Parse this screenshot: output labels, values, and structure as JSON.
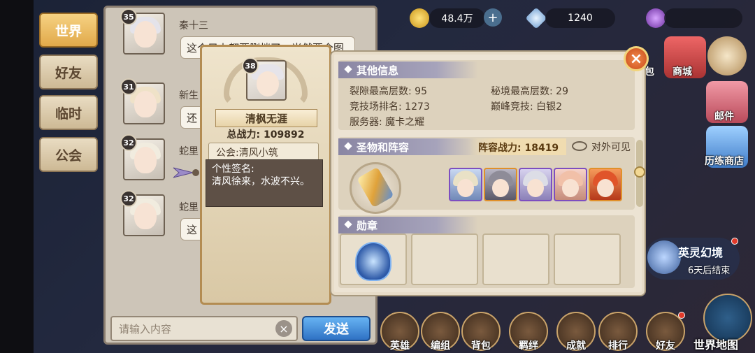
{
  "tabs": [
    {
      "label": "世界",
      "active": true
    },
    {
      "label": "好友",
      "active": false
    },
    {
      "label": "临时",
      "active": false
    },
    {
      "label": "公会",
      "active": false
    }
  ],
  "chat": [
    {
      "level": "35",
      "name": "秦十三",
      "message": "这个只上都要删档了，当然要全图"
    },
    {
      "level": "31",
      "name": "新生",
      "message": "还"
    },
    {
      "level": "32",
      "name": "蛇里",
      "message": ""
    },
    {
      "level": "32",
      "name": "蛇里",
      "message": "这"
    }
  ],
  "input": {
    "placeholder": "请输入内容",
    "send_label": "发送",
    "clear_symbol": "×"
  },
  "profile": {
    "level": "38",
    "name": "清枫无涯",
    "power_label": "总战力:",
    "power_value": "109892",
    "guild": "公会:清风小筑",
    "signature_label": "个性签名:",
    "signature_text": "清风徐来，水波不兴。"
  },
  "detail": {
    "other_title": "其他信息",
    "rift_label": "裂隙最高层数: 95",
    "secret_label": "秘境最高层数: 29",
    "arena_label": "竞技场排名: 1273",
    "peak_label": "巅峰竞技: 白银2",
    "server_label": "服务器: 魔卡之耀",
    "lineup_title": "圣物和阵容",
    "lineup_power": "阵容战力: 18419",
    "visibility": "对外可见",
    "medal_title": "勋章",
    "close_symbol": "×"
  },
  "heroes": [
    {
      "hair": "#e9e1c6",
      "accent": "#7d4ec0"
    },
    {
      "hair": "#8e8c98",
      "accent": "#e0902a"
    },
    {
      "hair": "#dcdde6",
      "accent": "#7d4ec0"
    },
    {
      "hair": "#f1c0a8",
      "accent": "#7d4ec0"
    },
    {
      "hair": "#e0542a",
      "accent": "#e0902a"
    }
  ],
  "topbar": {
    "gold": "48.4万",
    "plus": "+",
    "diamonds": "1240"
  },
  "side": {
    "shop": "商城",
    "mail": "邮件",
    "trial_shop": "历练商店",
    "partial_top": "包"
  },
  "event": {
    "title": "英灵幻境",
    "subtitle": "6天后结束"
  },
  "nav": [
    "英雄",
    "编组",
    "背包",
    "羁绊",
    "成就",
    "排行",
    "好友"
  ],
  "world_map": "世界地图",
  "colors": {
    "accent_gold": "#e1a94a",
    "send_blue": "#2f72c4",
    "close_orange": "#c94a18",
    "epic_purple": "#7d4ec0",
    "legend_orange": "#e0902a"
  }
}
